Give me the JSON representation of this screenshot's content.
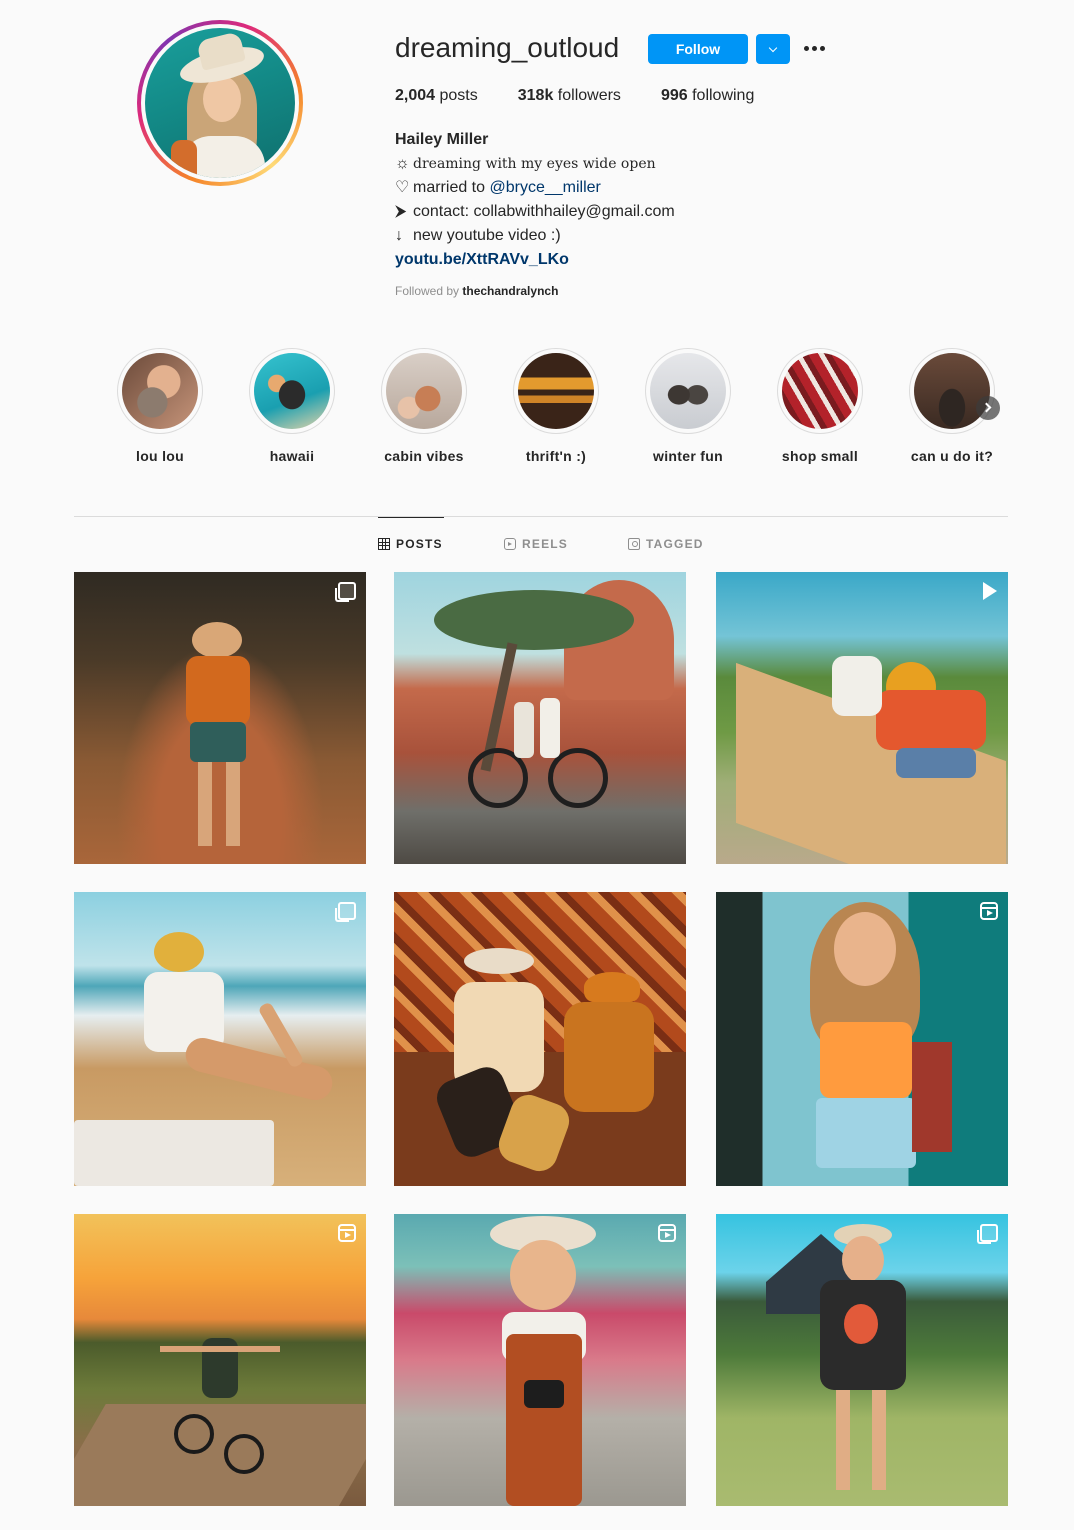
{
  "profile": {
    "username": "dreaming_outloud",
    "follow_label": "Follow",
    "posts_count": "2,004",
    "posts_label": "posts",
    "followers_count": "318k",
    "followers_label": "followers",
    "following_count": "996",
    "following_label": "following",
    "full_name": "Hailey Miller",
    "bio": {
      "line1_glyph": "☼",
      "line1_text": "dreaming with my eyes wide open",
      "line2_glyph": "♡",
      "line2_text": "married to ",
      "line2_tag": "@bryce__miller",
      "line3_glyph": "⮞",
      "line3_text": "contact: collabwithhailey@gmail.com",
      "line4_glyph": "↓",
      "line4_text": "new youtube video :)",
      "link": "youtu.be/XttRAVv_LKo"
    },
    "followed_by_prefix": "Followed by",
    "followed_by_user": "thechandralynch"
  },
  "highlights": [
    {
      "label": "lou lou"
    },
    {
      "label": "hawaii"
    },
    {
      "label": "cabin vibes"
    },
    {
      "label": "thrift'n :)"
    },
    {
      "label": "winter fun"
    },
    {
      "label": "shop small"
    },
    {
      "label": "can u do it?"
    }
  ],
  "tabs": [
    {
      "label": "POSTS",
      "icon": "grid-icon",
      "active": true
    },
    {
      "label": "REELS",
      "icon": "reels-icon",
      "active": false
    },
    {
      "label": "TAGGED",
      "icon": "tagged-icon",
      "active": false
    }
  ],
  "posts": [
    {
      "badge": "carousel-icon"
    },
    {
      "badge": "none"
    },
    {
      "badge": "video-icon"
    },
    {
      "badge": "carousel-icon"
    },
    {
      "badge": "none"
    },
    {
      "badge": "reel-icon"
    },
    {
      "badge": "reel-icon"
    },
    {
      "badge": "reel-icon"
    },
    {
      "badge": "carousel-icon"
    }
  ],
  "colors": {
    "accent": "#0095f6",
    "link": "#00376b",
    "muted": "#8e8e8e",
    "text": "#262626",
    "background": "#fafafa"
  }
}
